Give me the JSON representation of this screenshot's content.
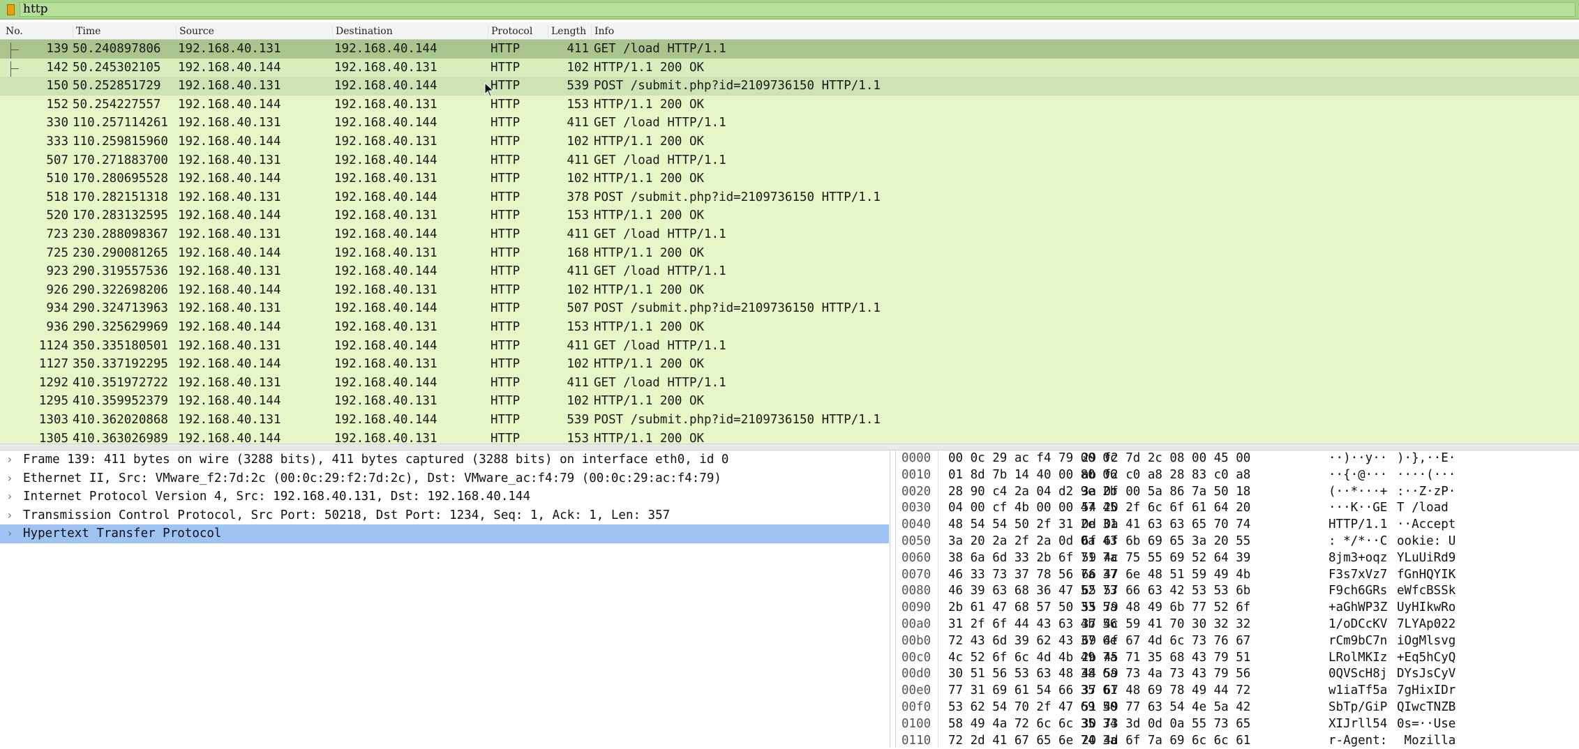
{
  "filter": {
    "value": "http"
  },
  "columns": [
    "No.",
    "Time",
    "Source",
    "Destination",
    "Protocol",
    "Length",
    "Info"
  ],
  "packets": [
    {
      "no": "139",
      "time": "50.240897806",
      "src": "192.168.40.131",
      "dst": "192.168.40.144",
      "proto": "HTTP",
      "len": "411",
      "info": "GET /load HTTP/1.1"
    },
    {
      "no": "142",
      "time": "50.245302105",
      "src": "192.168.40.144",
      "dst": "192.168.40.131",
      "proto": "HTTP",
      "len": "102",
      "info": "HTTP/1.1 200 OK"
    },
    {
      "no": "150",
      "time": "50.252851729",
      "src": "192.168.40.131",
      "dst": "192.168.40.144",
      "proto": "HTTP",
      "len": "539",
      "info": "POST /submit.php?id=2109736150 HTTP/1.1"
    },
    {
      "no": "152",
      "time": "50.254227557",
      "src": "192.168.40.144",
      "dst": "192.168.40.131",
      "proto": "HTTP",
      "len": "153",
      "info": "HTTP/1.1 200 OK"
    },
    {
      "no": "330",
      "time": "110.257114261",
      "src": "192.168.40.131",
      "dst": "192.168.40.144",
      "proto": "HTTP",
      "len": "411",
      "info": "GET /load HTTP/1.1"
    },
    {
      "no": "333",
      "time": "110.259815960",
      "src": "192.168.40.144",
      "dst": "192.168.40.131",
      "proto": "HTTP",
      "len": "102",
      "info": "HTTP/1.1 200 OK"
    },
    {
      "no": "507",
      "time": "170.271883700",
      "src": "192.168.40.131",
      "dst": "192.168.40.144",
      "proto": "HTTP",
      "len": "411",
      "info": "GET /load HTTP/1.1"
    },
    {
      "no": "510",
      "time": "170.280695528",
      "src": "192.168.40.144",
      "dst": "192.168.40.131",
      "proto": "HTTP",
      "len": "102",
      "info": "HTTP/1.1 200 OK"
    },
    {
      "no": "518",
      "time": "170.282151318",
      "src": "192.168.40.131",
      "dst": "192.168.40.144",
      "proto": "HTTP",
      "len": "378",
      "info": "POST /submit.php?id=2109736150 HTTP/1.1"
    },
    {
      "no": "520",
      "time": "170.283132595",
      "src": "192.168.40.144",
      "dst": "192.168.40.131",
      "proto": "HTTP",
      "len": "153",
      "info": "HTTP/1.1 200 OK"
    },
    {
      "no": "723",
      "time": "230.288098367",
      "src": "192.168.40.131",
      "dst": "192.168.40.144",
      "proto": "HTTP",
      "len": "411",
      "info": "GET /load HTTP/1.1"
    },
    {
      "no": "725",
      "time": "230.290081265",
      "src": "192.168.40.144",
      "dst": "192.168.40.131",
      "proto": "HTTP",
      "len": "168",
      "info": "HTTP/1.1 200 OK"
    },
    {
      "no": "923",
      "time": "290.319557536",
      "src": "192.168.40.131",
      "dst": "192.168.40.144",
      "proto": "HTTP",
      "len": "411",
      "info": "GET /load HTTP/1.1"
    },
    {
      "no": "926",
      "time": "290.322698206",
      "src": "192.168.40.144",
      "dst": "192.168.40.131",
      "proto": "HTTP",
      "len": "102",
      "info": "HTTP/1.1 200 OK"
    },
    {
      "no": "934",
      "time": "290.324713963",
      "src": "192.168.40.131",
      "dst": "192.168.40.144",
      "proto": "HTTP",
      "len": "507",
      "info": "POST /submit.php?id=2109736150 HTTP/1.1"
    },
    {
      "no": "936",
      "time": "290.325629969",
      "src": "192.168.40.144",
      "dst": "192.168.40.131",
      "proto": "HTTP",
      "len": "153",
      "info": "HTTP/1.1 200 OK"
    },
    {
      "no": "1124",
      "time": "350.335180501",
      "src": "192.168.40.131",
      "dst": "192.168.40.144",
      "proto": "HTTP",
      "len": "411",
      "info": "GET /load HTTP/1.1"
    },
    {
      "no": "1127",
      "time": "350.337192295",
      "src": "192.168.40.144",
      "dst": "192.168.40.131",
      "proto": "HTTP",
      "len": "102",
      "info": "HTTP/1.1 200 OK"
    },
    {
      "no": "1292",
      "time": "410.351972722",
      "src": "192.168.40.131",
      "dst": "192.168.40.144",
      "proto": "HTTP",
      "len": "411",
      "info": "GET /load HTTP/1.1"
    },
    {
      "no": "1295",
      "time": "410.359952379",
      "src": "192.168.40.144",
      "dst": "192.168.40.131",
      "proto": "HTTP",
      "len": "102",
      "info": "HTTP/1.1 200 OK"
    },
    {
      "no": "1303",
      "time": "410.362020868",
      "src": "192.168.40.131",
      "dst": "192.168.40.144",
      "proto": "HTTP",
      "len": "539",
      "info": "POST /submit.php?id=2109736150 HTTP/1.1"
    },
    {
      "no": "1305",
      "time": "410.363026989",
      "src": "192.168.40.144",
      "dst": "192.168.40.131",
      "proto": "HTTP",
      "len": "153",
      "info": "HTTP/1.1 200 OK"
    }
  ],
  "details": [
    "Frame 139: 411 bytes on wire (3288 bits), 411 bytes captured (3288 bits) on interface eth0, id 0",
    "Ethernet II, Src: VMware_f2:7d:2c (00:0c:29:f2:7d:2c), Dst: VMware_ac:f4:79 (00:0c:29:ac:f4:79)",
    "Internet Protocol Version 4, Src: 192.168.40.131, Dst: 192.168.40.144",
    "Transmission Control Protocol, Src Port: 50218, Dst Port: 1234, Seq: 1, Ack: 1, Len: 357",
    "Hypertext Transfer Protocol"
  ],
  "bytes": [
    {
      "off": "0000",
      "hex1": "00 0c 29 ac f4 79 00 0c",
      "hex2": "29 f2 7d 2c 08 00 45 00",
      "asc1": "··)··y··",
      "asc2": ")·},··E·"
    },
    {
      "off": "0010",
      "hex1": "01 8d 7b 14 40 00 80 06",
      "hex2": "ab f2 c0 a8 28 83 c0 a8",
      "asc1": "··{·@···",
      "asc2": "····(···"
    },
    {
      "off": "0020",
      "hex1": "28 90 c4 2a 04 d2 9e 2b",
      "hex2": "3a 0f 00 5a 86 7a 50 18",
      "asc1": "(··*···+",
      "asc2": ":··Z·zP·"
    },
    {
      "off": "0030",
      "hex1": "04 00 cf 4b 00 00 47 45",
      "hex2": "54 20 2f 6c 6f 61 64 20",
      "asc1": "···K··GE",
      "asc2": "T /load "
    },
    {
      "off": "0040",
      "hex1": "48 54 54 50 2f 31 2e 31",
      "hex2": "0d 0a 41 63 63 65 70 74",
      "asc1": "HTTP/1.1",
      "asc2": "··Accept"
    },
    {
      "off": "0050",
      "hex1": "3a 20 2a 2f 2a 0d 0a 43",
      "hex2": "6f 6f 6b 69 65 3a 20 55",
      "asc1": ": */*··C",
      "asc2": "ookie: U"
    },
    {
      "off": "0060",
      "hex1": "38 6a 6d 33 2b 6f 71 7a",
      "hex2": "59 4c 75 55 69 52 64 39",
      "asc1": "8jm3+oqz",
      "asc2": "YLuUiRd9"
    },
    {
      "off": "0070",
      "hex1": "46 33 73 37 78 56 7a 37",
      "hex2": "66 47 6e 48 51 59 49 4b",
      "asc1": "F3s7xVz7",
      "asc2": "fGnHQYIK"
    },
    {
      "off": "0080",
      "hex1": "46 39 63 68 36 47 52 73",
      "hex2": "65 57 66 63 42 53 53 6b",
      "asc1": "F9ch6GRs",
      "asc2": "eWfcBSSk"
    },
    {
      "off": "0090",
      "hex1": "2b 61 47 68 57 50 33 5a",
      "hex2": "55 79 48 49 6b 77 52 6f",
      "asc1": "+aGhWP3Z",
      "asc2": "UyHIkwRo"
    },
    {
      "off": "00a0",
      "hex1": "31 2f 6f 44 43 63 4b 56",
      "hex2": "37 4c 59 41 70 30 32 32",
      "asc1": "1/oDCcKV",
      "asc2": "7LYAp022"
    },
    {
      "off": "00b0",
      "hex1": "72 43 6d 39 62 43 37 6e",
      "hex2": "69 4f 67 4d 6c 73 76 67",
      "asc1": "rCm9bC7n",
      "asc2": "iOgMlsvg"
    },
    {
      "off": "00c0",
      "hex1": "4c 52 6f 6c 4d 4b 49 7a",
      "hex2": "2b 45 71 35 68 43 79 51",
      "asc1": "LRolMKIz",
      "asc2": "+Eq5hCyQ"
    },
    {
      "off": "00d0",
      "hex1": "30 51 56 53 63 48 38 6a",
      "hex2": "44 59 73 4a 73 43 79 56",
      "asc1": "0QVScH8j",
      "asc2": "DYsJsCyV"
    },
    {
      "off": "00e0",
      "hex1": "77 31 69 61 54 66 35 61",
      "hex2": "37 67 48 69 78 49 44 72",
      "asc1": "w1iaTf5a",
      "asc2": "7gHixIDr"
    },
    {
      "off": "00f0",
      "hex1": "53 62 54 70 2f 47 69 50",
      "hex2": "51 49 77 63 54 4e 5a 42",
      "asc1": "SbTp/GiP",
      "asc2": "QIwcTNZB"
    },
    {
      "off": "0100",
      "hex1": "58 49 4a 72 6c 6c 35 34",
      "hex2": "30 73 3d 0d 0a 55 73 65",
      "asc1": "XIJrll54",
      "asc2": "0s=··Use"
    },
    {
      "off": "0110",
      "hex1": "72 2d 41 67 65 6e 74 3a",
      "hex2": "20 4d 6f 7a 69 6c 6c 61",
      "asc1": "r-Agent:",
      "asc2": " Mozilla"
    }
  ],
  "colors": {
    "filter_bg": "#a6d58a",
    "row_bg": "#e6f6c6",
    "selected_row": "#a9c48d",
    "detail_selected": "#9ec3f4"
  }
}
